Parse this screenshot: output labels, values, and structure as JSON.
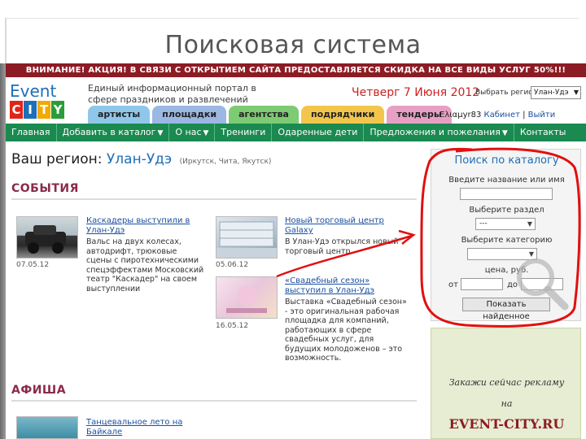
{
  "slide": {
    "title": "Поисковая система"
  },
  "promo": {
    "text": "ВНИМАНИЕ! АКЦИЯ! В СВЯЗИ С ОТКРЫТИЕМ САЙТА ПРЕДОСТАВЛЯЕТСЯ СКИДКА НА ВСЕ ВИДЫ УСЛУГ 50%!!!"
  },
  "header": {
    "logo_word": "Event",
    "logo_city": [
      "C",
      "I",
      "T",
      "Y"
    ],
    "tagline": "Единый информационный портал в сфере праздников и развлечений",
    "date": "Четверг 7 Июня 2012",
    "region_label": "Выбрать регион",
    "region_value": "Улан-Удэ",
    "user_name": "Ελιαμyr83",
    "cabinet_link": "Кабинет",
    "logout_link": "Выйти"
  },
  "category_tabs": [
    {
      "label": "артисты",
      "color": "#8fc7ea"
    },
    {
      "label": "площадки",
      "color": "#9bb7e3"
    },
    {
      "label": "агентства",
      "color": "#7dcb73"
    },
    {
      "label": "подрядчики",
      "color": "#f3c64b"
    },
    {
      "label": "тендеры",
      "color": "#e7a0c4"
    }
  ],
  "nav": {
    "items": [
      {
        "label": "Главная",
        "dropdown": false
      },
      {
        "label": "Добавить в каталог",
        "dropdown": true
      },
      {
        "label": "О нас",
        "dropdown": true
      },
      {
        "label": "Тренинги",
        "dropdown": false
      },
      {
        "label": "Одаренные дети",
        "dropdown": false
      },
      {
        "label": "Предложения и пожелания",
        "dropdown": true
      },
      {
        "label": "Контакты",
        "dropdown": false
      }
    ]
  },
  "main": {
    "region_prefix": "Ваш регион:",
    "region_city": "Улан-Удэ",
    "region_others": "(Иркутск, Чита, Якутск)",
    "events_heading": "СОБЫТИЯ",
    "afisha_heading": "АФИША",
    "events": [
      {
        "title": "Каскадеры выступили в Улан-Удэ",
        "text": "Вальс на двух колесах, автодрифт, трюковые сцены с пиротехническими спецэффектами Московский театр \"Каскадер\" на своем выступлении",
        "date": "07.05.12"
      },
      {
        "title": "Новый торговый центр Galaxy",
        "text": "В Улан-Удэ открылся новый торговый центр.",
        "date": "05.06.12"
      },
      {
        "title": "«Свадебный сезон» выступил в Улан-Удэ",
        "text": "Выставка «Свадебный сезон» - это оригинальная рабочая площадка для компаний, работающих в сфере свадебных услуг, для будущих молодоженов – это возможность.",
        "date": "16.05.12"
      }
    ],
    "afisha": [
      {
        "title": "Танцевальное лето на Байкале"
      }
    ]
  },
  "search_panel": {
    "title": "Поиск по каталогу",
    "name_label": "Введите название или имя",
    "section_label": "Выберите раздел",
    "section_value": "---",
    "category_label": "Выберите категорию",
    "price_label": "цена, руб.",
    "from_label": "от",
    "to_label": "до",
    "button_label": "Показать найденное"
  },
  "ad": {
    "line1": "Закажи сейчас рекламу",
    "line2": "на",
    "site": "EVENT-CITY.RU"
  },
  "colors": {
    "nav_green": "#1a8a50",
    "promo_red": "#8c1c24",
    "link_blue": "#1a4fa0",
    "annotation_red": "#e01010",
    "logo_city_colors": [
      "#e2231a",
      "#1e6fb8",
      "#f2a900",
      "#2a9d3a"
    ]
  }
}
